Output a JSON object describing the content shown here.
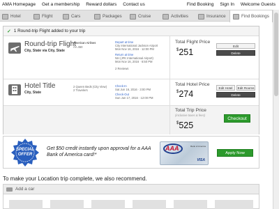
{
  "topnav": {
    "left": [
      "AMA Homepage",
      "Get a membership",
      "Reward dollars",
      "Contact us"
    ],
    "right": [
      "Find Booking",
      "Sign In",
      "Welcome Guests"
    ]
  },
  "tabs": [
    {
      "label": "Hotel",
      "icon": "hotel-icon"
    },
    {
      "label": "Flight",
      "icon": "plane-icon"
    },
    {
      "label": "Cars",
      "icon": "car-icon"
    },
    {
      "label": "Packages",
      "icon": "package-icon"
    },
    {
      "label": "Cruise",
      "icon": "ship-icon"
    },
    {
      "label": "Activities",
      "icon": "activity-icon"
    },
    {
      "label": "Insurance",
      "icon": "umbrella-icon"
    },
    {
      "label": "Find Bookings",
      "icon": "search-icon"
    }
  ],
  "cart": {
    "banner": "1 Round-trip Flight added to your trip",
    "flight": {
      "title": "Round-trip Flight",
      "route": "City, State via City, State",
      "airline": "American Airlines",
      "flight_no": "AA 450",
      "depart_label": "Depart at time",
      "depart_line1": "City International Jackson Airport",
      "depart_line2": "Mon Nov 16, 2016 · 12:00 PM",
      "return_label": "Return at time",
      "return_line1": "NH (JFK International Airport)",
      "return_line2": "Mon Nov 16, 2016 · 6:50 PM",
      "stops": "2 Reviews",
      "price_label": "Total Flight Price",
      "price": "251",
      "currency": "$",
      "edit": "Edit",
      "delete": "Delete"
    },
    "hotel": {
      "title": "Hotel Title",
      "location": "City, State",
      "room": "2 Queen Beds (City View)",
      "guests": "2 Travelers",
      "checkin_label": "Check-In",
      "checkin_date": "Sat Jun 16, 2016 · 3:00 PM",
      "checkout_label": "Check-Out",
      "checkout_date": "Sun Jun 17, 2016 · 12:00 PM",
      "price_label": "Total Hotel Price",
      "price": "274",
      "currency": "$",
      "edit_hotel": "Edit Hotel",
      "edit_rooms": "Edit Rooms",
      "delete": "Delete"
    },
    "total": {
      "label": "Total Trip Price",
      "sublabel": "(inclusive taxes & fees)",
      "price": "525",
      "currency": "$",
      "checkout": "Checkout"
    }
  },
  "promo": {
    "badge_line1": "SPECIAL",
    "badge_line2": "OFFER",
    "text": "Get $50 credit instantly upon approval for a AAA Bank of America card!*",
    "card_brand": "AAA",
    "card_bank": "Bank of America",
    "card_network": "VISA",
    "apply": "Apply Now"
  },
  "recommend_text": "To make your Location trip complete, we also recommend.",
  "add_car": "Add a car",
  "colors": {
    "accent_green": "#2c9a2c",
    "badge_blue": "#2a5fbe",
    "link_blue": "#3366cc"
  }
}
